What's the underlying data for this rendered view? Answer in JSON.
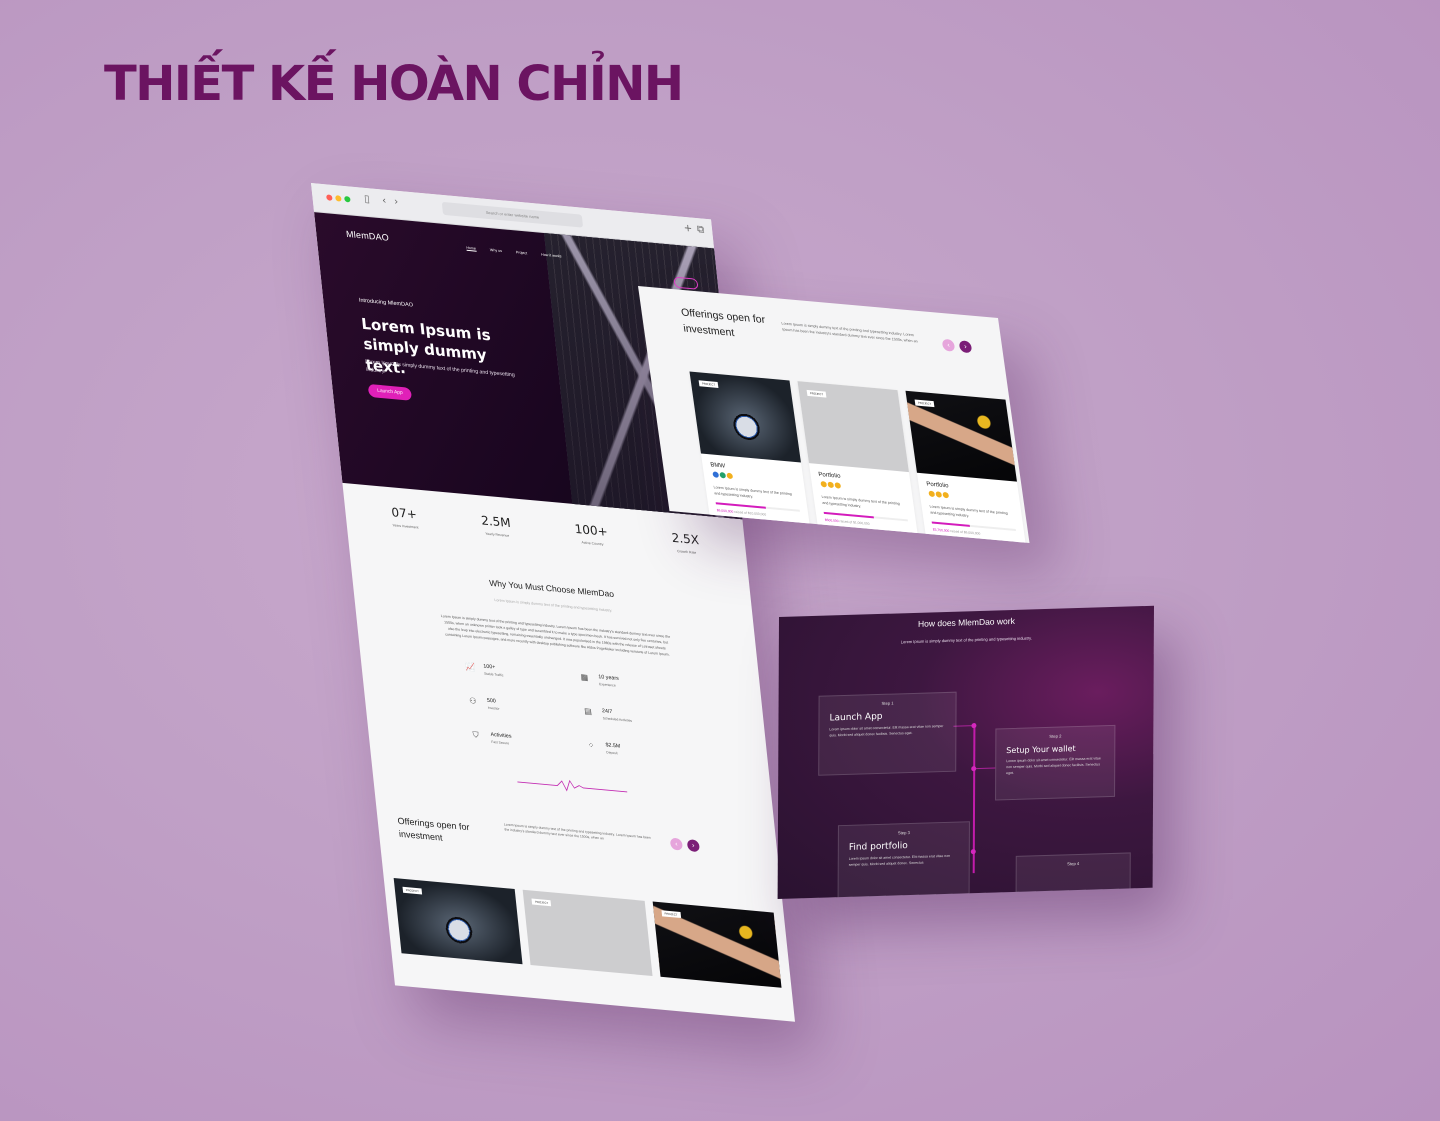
{
  "headline": "THIẾT KẾ HOÀN CHỈNH",
  "browser": {
    "url_placeholder": "Search or enter website name"
  },
  "landing": {
    "logo": "MlemDAO",
    "nav": [
      "Home",
      "Why us",
      "Project",
      "How it works"
    ],
    "intro": "Introducing MlemDAO",
    "hero_title": "Lorem Ipsum is simply dummy text.",
    "hero_sub": "Lorem Ipsum is simply dummy text of the printing and typesetting industry.",
    "cta": "Launch App",
    "stats": [
      {
        "value": "07+",
        "label": "Years Investment"
      },
      {
        "value": "2.5M",
        "label": "Yearly Revenue"
      },
      {
        "value": "100+",
        "label": "Active Country"
      },
      {
        "value": "2.5X",
        "label": "Growth Rate"
      }
    ],
    "why_title": "Why You Must Choose MlemDao",
    "why_sub": "Lorem Ipsum is simply dummy text of the printing and typesetting industry.",
    "why_body": "Lorem Ipsum is simply dummy text of the printing and typesetting industry. Lorem Ipsum has been the industry's standard dummy text ever since the 1500s, when an unknown printer took a galley of type and scrambled it to make a type specimen book. It has survived not only five centuries, but also the leap into electronic typesetting, remaining essentially unchanged. It was popularised in the 1960s with the release of Letraset sheets containing Lorem Ipsum passages, and more recently with desktop publishing software like Aldus PageMaker including versions of Lorem Ipsum.",
    "features": [
      {
        "icon": "chart-icon",
        "value": "100+",
        "label": "Stable Traffic"
      },
      {
        "icon": "building-icon",
        "value": "10 years",
        "label": "Experience"
      },
      {
        "icon": "users-icon",
        "value": "500",
        "label": "Investor"
      },
      {
        "icon": "calendar-icon",
        "value": "24/7",
        "label": "Scheduled Activities"
      },
      {
        "icon": "shield-icon",
        "value": "Activities",
        "label": "Fast Secure"
      },
      {
        "icon": "coins-icon",
        "value": "$2.5M",
        "label": "Deposit"
      }
    ],
    "offer_title": "Offerings open for investment",
    "offer_desc": "Lorem Ipsum is simply dummy text of the printing and typesetting industry. Lorem Ipsum has been the industry's standard dummy text ever since the 1500s, when an",
    "card_tag": "PROJECT"
  },
  "offerings": {
    "title": "Offerings open for investment",
    "desc": "Lorem Ipsum is simply dummy text of the printing and typesetting industry. Lorem Ipsum has been the industry's standard dummy text ever since the 1500s, when an",
    "tag": "PROJECT",
    "cards": [
      {
        "name": "BMW",
        "body": "Lorem Ipsum is simply dummy text of the printing and typesetting industry.",
        "raised": "$6,000,000",
        "goal": "raised of $10,000,000",
        "progress": 0.6
      },
      {
        "name": "Portfolio",
        "body": "Lorem Ipsum is simply dummy text of the printing and typesetting industry.",
        "raised": "$600,000",
        "goal": "raised of $1,000,000",
        "progress": 0.6
      },
      {
        "name": "Portfolio",
        "body": "Lorem Ipsum is simply dummy text of the printing and typesetting industry.",
        "raised": "$3,750,000",
        "goal": "raised of $6,000,000",
        "progress": 0.45
      }
    ],
    "coin_colors": [
      "#2f6fd6",
      "#22a06b",
      "#f2b01e"
    ]
  },
  "how": {
    "title": "How does MlemDao work",
    "sub": "Lorem Ipsum is simply dummy text of the printing and typesetting industry.",
    "steps": [
      {
        "n": "Step 1",
        "t": "Launch App",
        "b": "Lorem ipsum dolor sit amet consectetur. Elit massa erat vitae non semper quis. Morbi sed aliquet donec facilisis. Senectus eget."
      },
      {
        "n": "Step 2",
        "t": "Setup Your wallet",
        "b": "Lorem ipsum dolor sit amet consectetur. Elit massa erat vitae non semper quis. Morbi sed aliquet donec facilisis. Senectus eget."
      },
      {
        "n": "Step 3",
        "t": "Find portfolio",
        "b": "Lorem ipsum dolor sit amet consectetur. Elit massa erat vitae non semper quis. Morbi sed aliquet donec. Senectus"
      },
      {
        "n": "Step 4",
        "t": "",
        "b": ""
      }
    ]
  }
}
